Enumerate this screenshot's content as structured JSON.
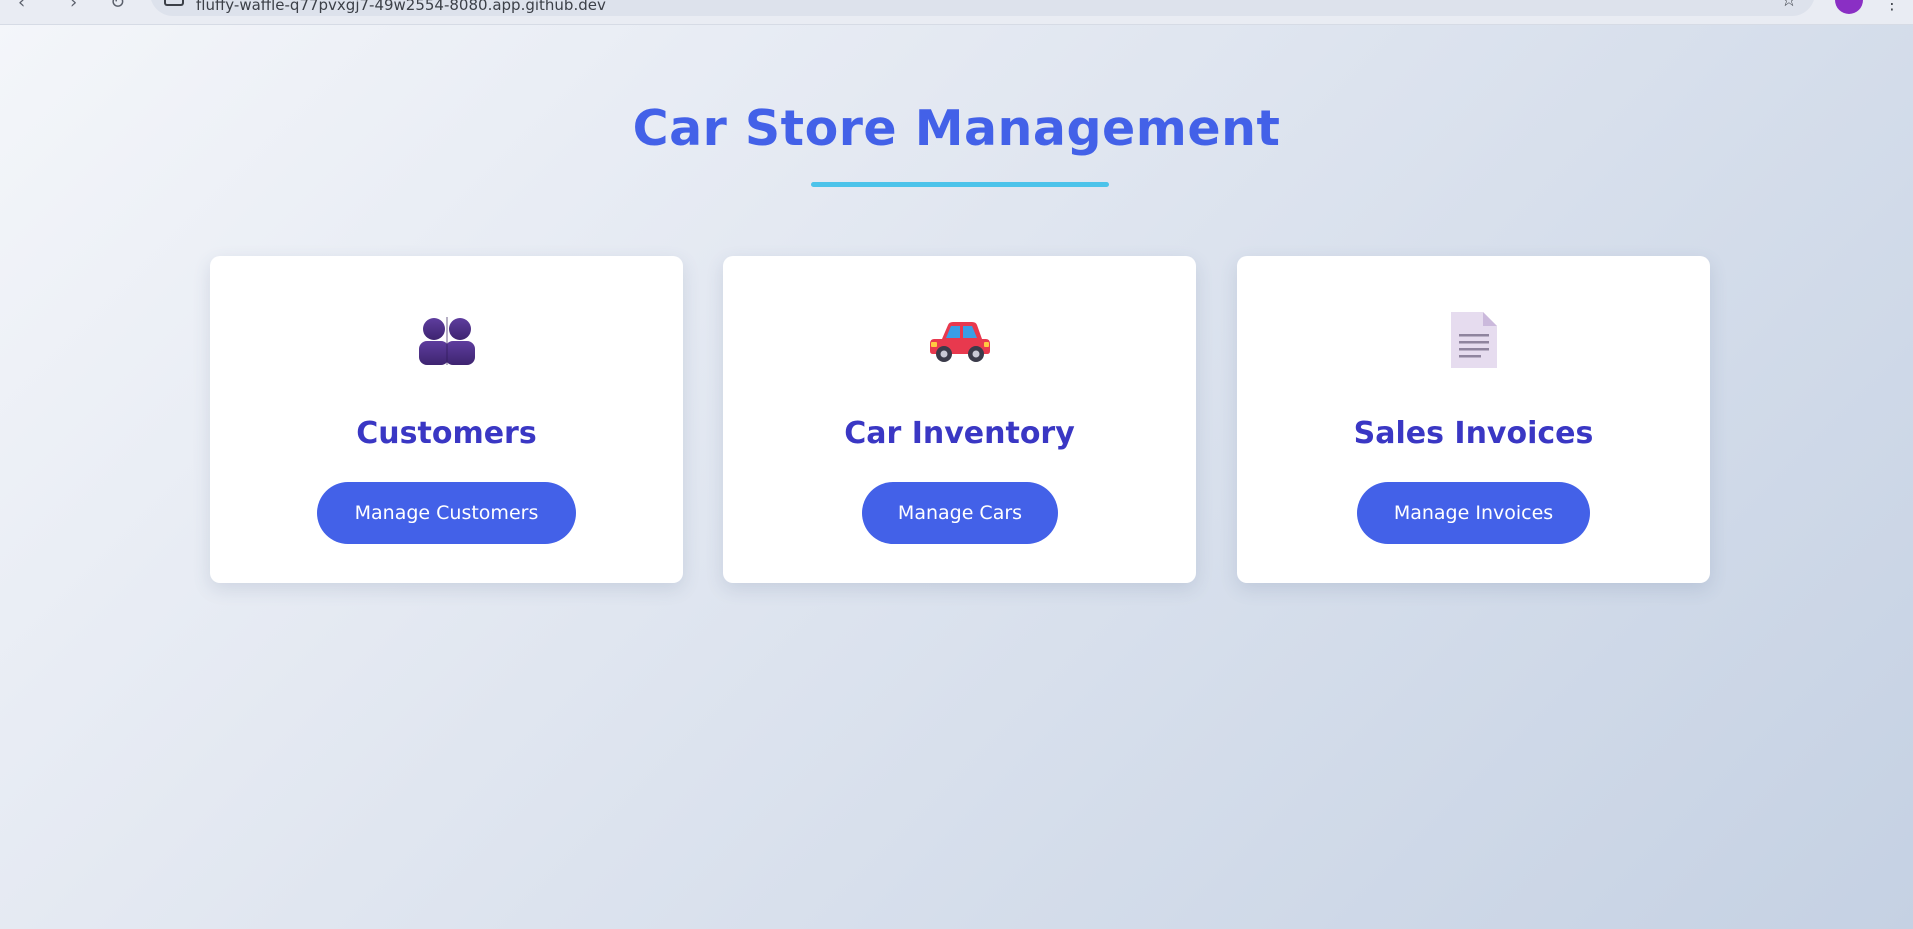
{
  "browser": {
    "url": "fluffy-waffle-q77pvxgj7-49w2554-8080.app.github.dev",
    "nav_back": "‹",
    "nav_forward": "›",
    "nav_reload": "↻",
    "star": "☆",
    "menu": "⋮"
  },
  "header": {
    "title": "Car Store Management",
    "accent_color": "#4361e8",
    "underline_color": "#4cc3ea"
  },
  "cards": [
    {
      "icon": "people-icon",
      "title": "Customers",
      "button_label": "Manage Customers"
    },
    {
      "icon": "car-icon",
      "title": "Car Inventory",
      "button_label": "Manage Cars"
    },
    {
      "icon": "document-icon",
      "title": "Sales Invoices",
      "button_label": "Manage Invoices"
    }
  ]
}
